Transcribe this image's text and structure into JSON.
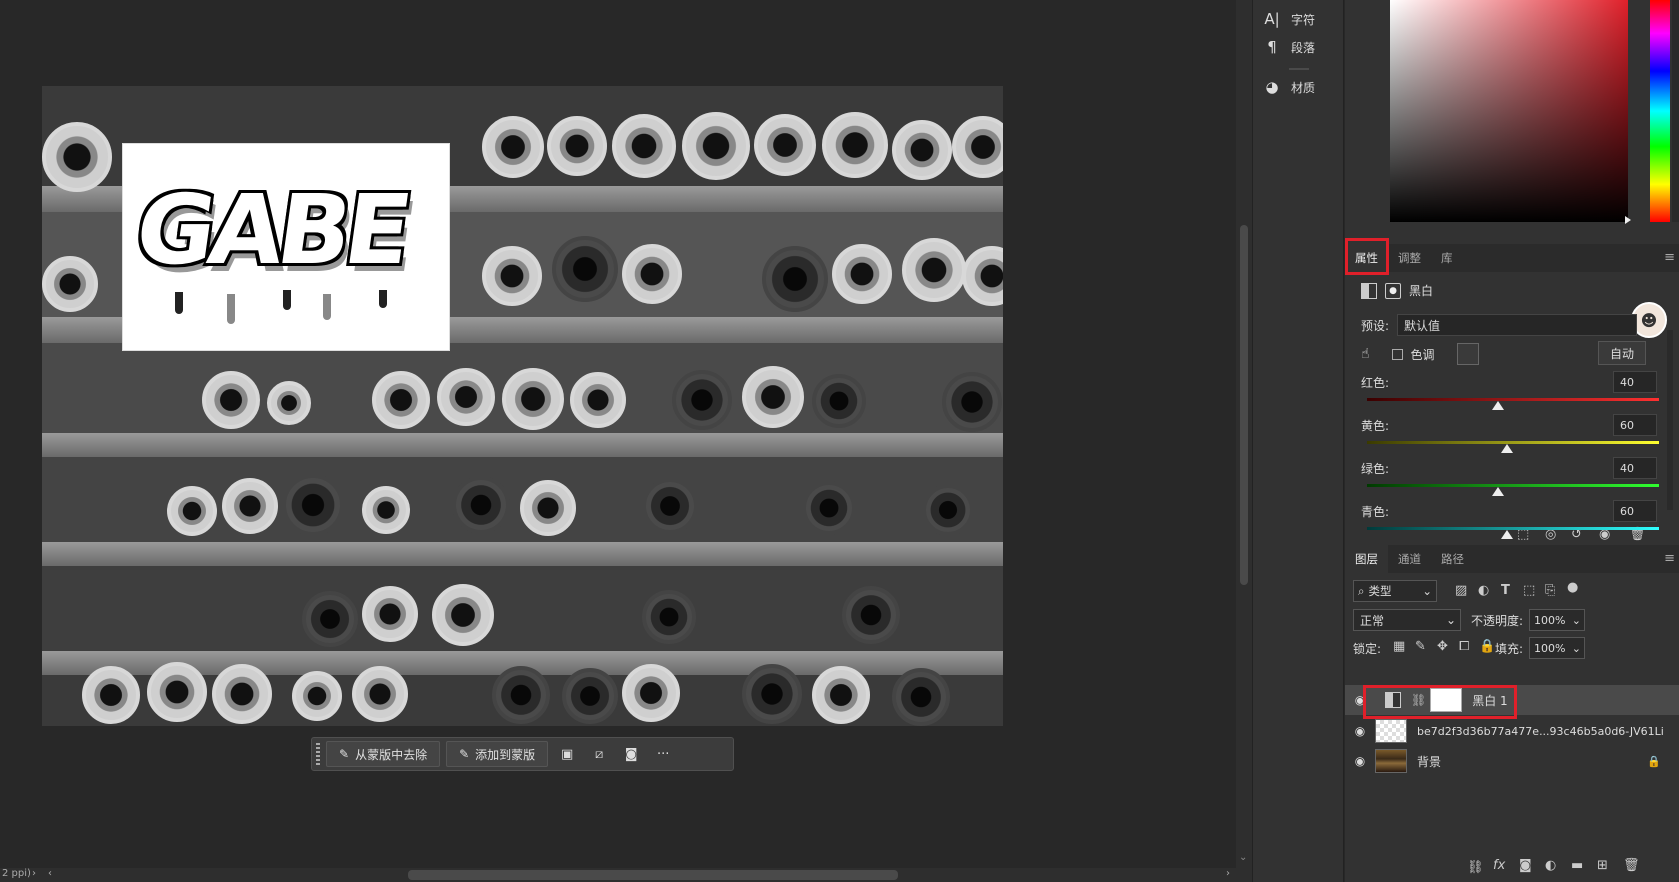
{
  "task_bar": {
    "remove_from_mask": "从蒙版中去除",
    "add_to_mask": "添加到蒙版"
  },
  "status": {
    "zoom_fragment": "2 ppi)"
  },
  "dock": {
    "items": [
      {
        "label": "字符",
        "icon": "character-icon"
      },
      {
        "label": "段落",
        "icon": "paragraph-icon"
      },
      {
        "label": "材质",
        "icon": "material-icon"
      }
    ]
  },
  "properties": {
    "tabs": [
      "属性",
      "调整",
      "库"
    ],
    "active_tab": "属性",
    "adjustment_name": "黑白",
    "preset_label": "预设:",
    "preset_value": "默认值",
    "tint_label": "色调",
    "auto_label": "自动",
    "sliders": [
      {
        "label": "红色:",
        "value": 40,
        "color_from": "#3a0000",
        "color_to": "#ff3030",
        "pos": 0.45
      },
      {
        "label": "黄色:",
        "value": 60,
        "color_from": "#3a3a00",
        "color_to": "#ffff30",
        "pos": 0.48
      },
      {
        "label": "绿色:",
        "value": 40,
        "color_from": "#003a00",
        "color_to": "#30ff30",
        "pos": 0.45
      },
      {
        "label": "青色:",
        "value": 60,
        "color_from": "#003a3a",
        "color_to": "#30ffff",
        "pos": 0.48
      }
    ]
  },
  "layers": {
    "tabs": [
      "图层",
      "通道",
      "路径"
    ],
    "active_tab": "图层",
    "filter_label": "类型",
    "blend_mode": "正常",
    "opacity_label": "不透明度:",
    "opacity_value": "100%",
    "lock_label": "锁定:",
    "fill_label": "填充:",
    "fill_value": "100%",
    "items": [
      {
        "name": "黑白 1",
        "type": "adjustment",
        "selected": true
      },
      {
        "name": "be7d2f3d36b77a477e...93c46b5a0d6-JV61Li",
        "type": "smart-object",
        "selected": false
      },
      {
        "name": "背景",
        "type": "background",
        "selected": false,
        "locked": true
      }
    ]
  },
  "canvas": {
    "graffiti_text": "GABE"
  }
}
